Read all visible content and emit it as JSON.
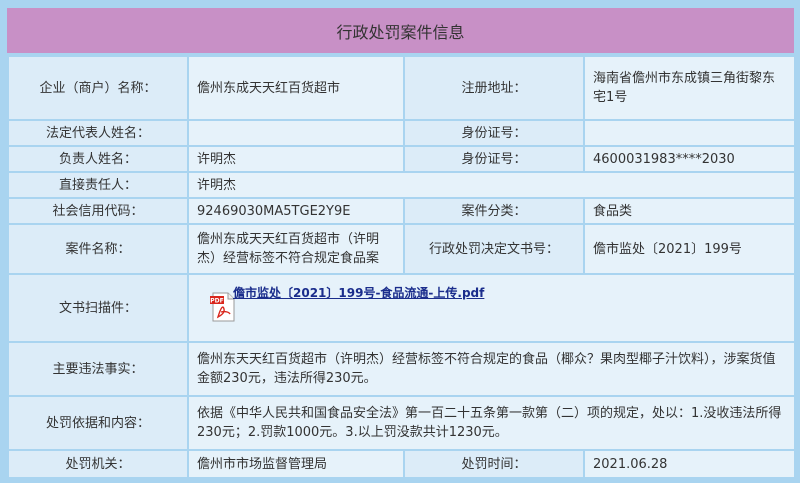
{
  "title": "行政处罚案件信息",
  "rows": {
    "company_label": "企业（商户）名称：",
    "company_value": "儋州东成天天红百货超市",
    "address_label": "注册地址：",
    "address_value": "海南省儋州市东成镇三角街黎东宅1号",
    "legal_rep_label": "法定代表人姓名：",
    "legal_rep_value": "",
    "legal_id_label": "身份证号：",
    "legal_id_value": "",
    "principal_label": "负责人姓名：",
    "principal_value": "许明杰",
    "principal_id_label": "身份证号：",
    "principal_id_value": "4600031983****2030",
    "direct_label": "直接责任人：",
    "direct_value": "许明杰",
    "credit_label": "社会信用代码：",
    "credit_value": "92469030MA5TGE2Y9E",
    "category_label": "案件分类：",
    "category_value": "食品类",
    "case_name_label": "案件名称：",
    "case_name_value": "儋州东成天天红百货超市（许明杰）经营标签不符合规定食品案",
    "decision_label": "行政处罚决定文书号：",
    "decision_value": "儋市监处〔2021〕199号",
    "scan_label": "文书扫描件：",
    "scan_link": "儋市监处〔2021〕199号-食品流通-上传.pdf",
    "facts_label": "主要违法事实：",
    "facts_value": "儋州东天天红百货超市（许明杰）经营标签不符合规定的食品（椰众？果肉型椰子汁饮料），涉案货值金额230元，违法所得230元。",
    "basis_label": "处罚依据和内容：",
    "basis_value": "依据《中华人民共和国食品安全法》第一百二十五条第一款第（二）项的规定，处以：1.没收违法所得230元；2.罚款1000元。3.以上罚没款共计1230元。",
    "authority_label": "处罚机关：",
    "authority_value": "儋州市市场监督管理局",
    "date_label": "处罚时间：",
    "date_value": "2021.06.28"
  },
  "icons": {
    "pdf": "pdf-file-icon"
  },
  "colors": {
    "header_bg": "#c890c6",
    "frame_bg": "#a9d4f0",
    "cell_bg": "#dcecf8",
    "link": "#1a2d8c",
    "pdf_red": "#d9261c"
  }
}
